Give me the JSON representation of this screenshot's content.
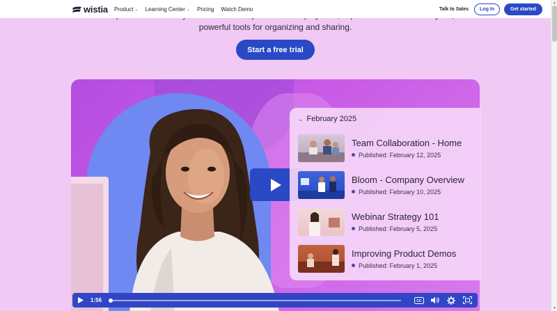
{
  "nav": {
    "logo_text": "wistia",
    "links": [
      {
        "label": "Product",
        "has_menu": true
      },
      {
        "label": "Learning Center",
        "has_menu": true
      },
      {
        "label": "Pricing",
        "has_menu": false
      },
      {
        "label": "Watch Demo",
        "has_menu": false
      }
    ],
    "talk_to_sales": "Talk to Sales",
    "login": "Log In",
    "get_started": "Get started"
  },
  "hero": {
    "line1": "Take complete control over your videos with top-notch video playback, super-detailed video analytics, and",
    "line2": "powerful tools for organizing and sharing.",
    "cta": "Start a free trial"
  },
  "playlist": {
    "month": "February 2025",
    "items": [
      {
        "title": "Team Collaboration - Home",
        "date": "Published: February 12, 2025"
      },
      {
        "title": "Bloom - Company Overview",
        "date": "Published: February 10, 2025"
      },
      {
        "title": "Webinar Strategy 101",
        "date": "Published: February 5, 2025"
      },
      {
        "title": "Improving Product Demos",
        "date": "Published: February 1, 2025"
      }
    ]
  },
  "player": {
    "time": "1:56",
    "progress": 0
  },
  "colors": {
    "brand": "#2949c6",
    "background": "#f1c9f5"
  }
}
